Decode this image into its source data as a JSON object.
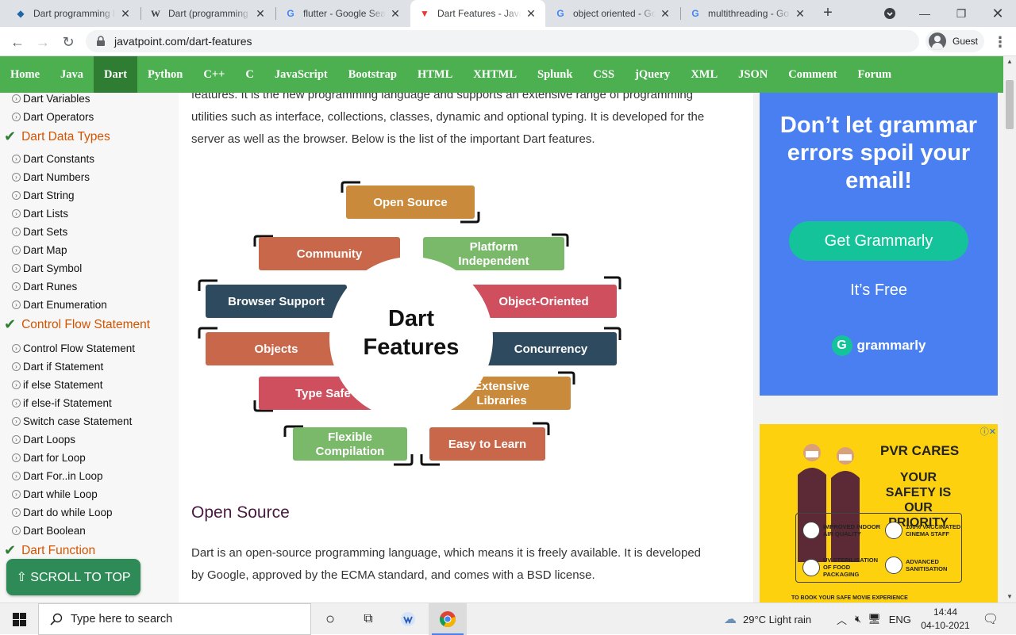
{
  "browser": {
    "tabs": [
      {
        "label": "Dart programming l",
        "icon": "dart-icon",
        "active": false
      },
      {
        "label": "Dart (programming",
        "icon": "wikipedia-icon",
        "active": false
      },
      {
        "label": "flutter - Google Sea",
        "icon": "google-icon",
        "active": false
      },
      {
        "label": "Dart Features - Java",
        "icon": "javatpoint-icon",
        "active": true
      },
      {
        "label": "object oriented - Go",
        "icon": "google-icon",
        "active": false
      },
      {
        "label": "multithreading - Go",
        "icon": "google-icon",
        "active": false
      }
    ],
    "url": "javatpoint.com/dart-features",
    "profile_label": "Guest"
  },
  "site_nav": {
    "items": [
      "Home",
      "Java",
      "Dart",
      "Python",
      "C++",
      "C",
      "JavaScript",
      "Bootstrap",
      "HTML",
      "XHTML",
      "Splunk",
      "CSS",
      "jQuery",
      "XML",
      "JSON",
      "Comment",
      "Forum"
    ],
    "current": "Dart",
    "color": "#4caf50"
  },
  "sidebar": {
    "entries": [
      {
        "type": "item",
        "label": "Dart Variables"
      },
      {
        "type": "item",
        "label": "Dart Operators"
      },
      {
        "type": "head",
        "label": "Dart Data Types"
      },
      {
        "type": "item",
        "label": "Dart Constants"
      },
      {
        "type": "item",
        "label": "Dart Numbers"
      },
      {
        "type": "item",
        "label": "Dart String"
      },
      {
        "type": "item",
        "label": "Dart Lists"
      },
      {
        "type": "item",
        "label": "Dart Sets"
      },
      {
        "type": "item",
        "label": "Dart Map"
      },
      {
        "type": "item",
        "label": "Dart Symbol"
      },
      {
        "type": "item",
        "label": "Dart Runes"
      },
      {
        "type": "item",
        "label": "Dart Enumeration"
      },
      {
        "type": "head",
        "label": "Control Flow Statement"
      },
      {
        "type": "item",
        "label": "Control Flow Statement"
      },
      {
        "type": "item",
        "label": "Dart if Statement"
      },
      {
        "type": "item",
        "label": "if else Statement"
      },
      {
        "type": "item",
        "label": "if else-if Statement"
      },
      {
        "type": "item",
        "label": "Switch case Statement"
      },
      {
        "type": "item",
        "label": "Dart Loops"
      },
      {
        "type": "item",
        "label": "Dart for Loop"
      },
      {
        "type": "item",
        "label": "Dart For..in Loop"
      },
      {
        "type": "item",
        "label": "Dart while Loop"
      },
      {
        "type": "item",
        "label": "Dart do while Loop"
      },
      {
        "type": "item",
        "label": "Dart Boolean"
      },
      {
        "type": "head",
        "label": "Dart Function"
      }
    ],
    "scroll_top_label": "⇧ SCROLL TO TOP"
  },
  "main": {
    "intro_line1": "features. It is the new programming language and supports an extensive range of programming",
    "intro_line2": "utilities such as interface, collections, classes, dynamic and optional typing. It is developed for the",
    "intro_line3": "server as well as the browser. Below is the list of the important Dart features.",
    "diagram": {
      "center_line1": "Dart",
      "center_line2": "Features",
      "features": [
        {
          "label": "Open Source",
          "color": "#c98a3c"
        },
        {
          "label": "Community",
          "color": "#c9674a"
        },
        {
          "label": "Platform Independent",
          "color": "#7ab86a"
        },
        {
          "label": "Browser Support",
          "color": "#2e4a5f"
        },
        {
          "label": "Object-Oriented",
          "color": "#d04f5f"
        },
        {
          "label": "Objects",
          "color": "#c9674a"
        },
        {
          "label": "Concurrency",
          "color": "#2e4a5f"
        },
        {
          "label": "Type Safe",
          "color": "#d04f5f"
        },
        {
          "label": "Extensive Libraries",
          "color": "#c98a3c"
        },
        {
          "label": "Flexible Compilation",
          "color": "#7ab86a"
        },
        {
          "label": "Easy to Learn",
          "color": "#c9674a"
        }
      ]
    },
    "section_heading": "Open Source",
    "section_line1": "Dart is an open-source programming language, which means it is freely available. It is developed",
    "section_line2": "by Google, approved by the ECMA standard, and comes with a BSD license."
  },
  "ads": {
    "grammarly": {
      "headline": "Don’t let grammar errors spoil your email!",
      "cta": "Get Grammarly",
      "subtext": "It’s Free",
      "brand": "grammarly",
      "color": "#4a7ff2"
    },
    "pvr": {
      "logo": "PVR CARES",
      "headline": "YOUR SAFETY IS OUR PRIORITY",
      "features": [
        "IMPROVED INDOOR AIR QUALITY",
        "100% VACCINATED CINEMA STAFF",
        "UV STERILISATION OF FOOD PACKAGING",
        "ADVANCED SANITISATION"
      ],
      "footer": "TO BOOK YOUR SAFE MOVIE EXPERIENCE"
    }
  },
  "taskbar": {
    "search_placeholder": "Type here to search",
    "weather": "29°C  Light rain",
    "language": "ENG",
    "time": "14:44",
    "date": "04-10-2021"
  }
}
